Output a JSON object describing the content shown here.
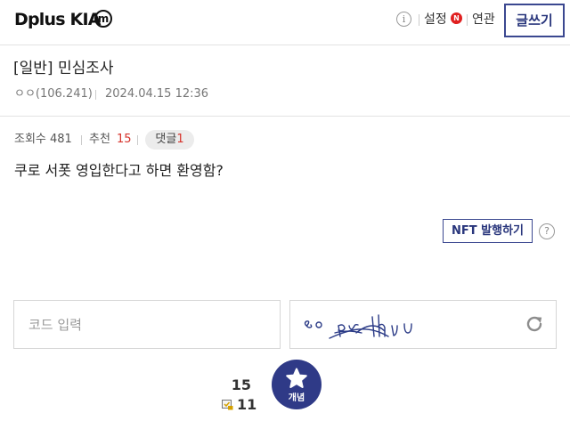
{
  "header": {
    "logo_text": "Dplus KIA",
    "logo_mark": "m",
    "info_icon": "info-icon",
    "settings_label": "설정",
    "new_badge": "N",
    "related_label": "연관",
    "write_label": "글쓰기"
  },
  "post": {
    "title": "[일반] 민심조사",
    "author": "ㅇㅇ(106.241)",
    "date": "2024.04.15 12:36",
    "views_text": "조회수 481",
    "recommend_label": "추천",
    "recommend_count": "15",
    "comment_label": "댓글",
    "comment_count": "1",
    "body": "쿠로 서폿 영입한다고 하면 환영함?",
    "nft_label": "NFT 발행하기",
    "help_icon": "question-icon"
  },
  "captcha": {
    "placeholder": "코드 입력",
    "refresh_icon": "refresh-icon"
  },
  "vote": {
    "up_count": "15",
    "down_count": "11",
    "button_label": "개념",
    "star_icon": "star-icon"
  },
  "colors": {
    "accent": "#2f3a87",
    "red": "#d6332c"
  }
}
